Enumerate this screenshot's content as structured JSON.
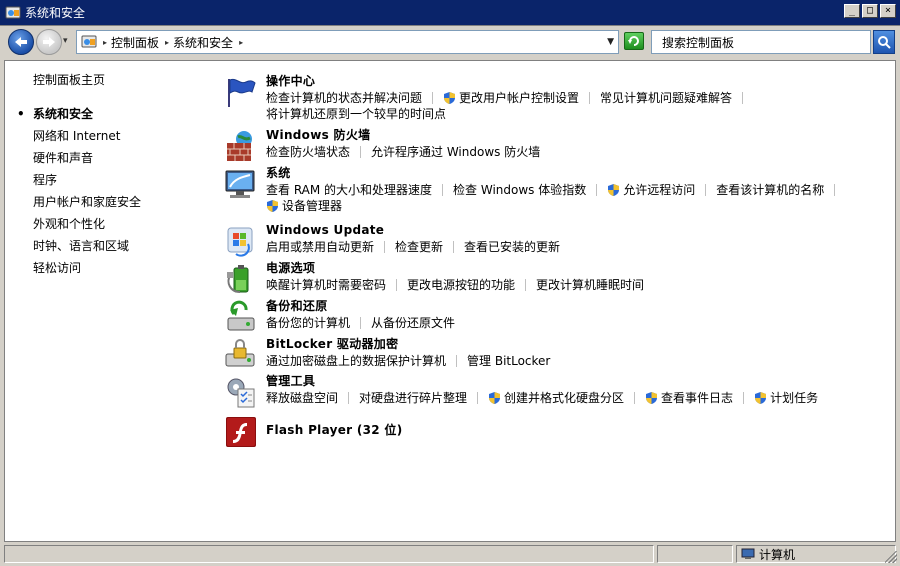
{
  "window": {
    "title": "系统和安全"
  },
  "nav": {
    "breadcrumbs": [
      "控制面板",
      "系统和安全"
    ],
    "search_placeholder": "搜索控制面板"
  },
  "sidebar": {
    "home": "控制面板主页",
    "items": [
      {
        "label": "系统和安全",
        "active": true
      },
      {
        "label": "网络和 Internet"
      },
      {
        "label": "硬件和声音"
      },
      {
        "label": "程序"
      },
      {
        "label": "用户帐户和家庭安全"
      },
      {
        "label": "外观和个性化"
      },
      {
        "label": "时钟、语言和区域"
      },
      {
        "label": "轻松访问"
      }
    ]
  },
  "sections": [
    {
      "title": "操作中心",
      "icon": "flag-icon",
      "links": [
        "检查计算机的状态并解决问题",
        "更改用户帐户控制设置",
        "常见计算机问题疑难解答",
        "将计算机还原到一个较早的时间点"
      ]
    },
    {
      "title": "Windows 防火墙",
      "icon": "firewall-icon",
      "links": [
        "检查防火墙状态",
        "允许程序通过 Windows 防火墙"
      ]
    },
    {
      "title": "系统",
      "icon": "computer-icon",
      "links": [
        "查看 RAM 的大小和处理器速度",
        "检查 Windows 体验指数",
        "允许远程访问",
        "查看该计算机的名称",
        "设备管理器"
      ]
    },
    {
      "title": "Windows Update",
      "icon": "windows-update-icon",
      "links": [
        "启用或禁用自动更新",
        "检查更新",
        "查看已安装的更新"
      ]
    },
    {
      "title": "电源选项",
      "icon": "power-icon",
      "links": [
        "唤醒计算机时需要密码",
        "更改电源按钮的功能",
        "更改计算机睡眠时间"
      ]
    },
    {
      "title": "备份和还原",
      "icon": "backup-icon",
      "links": [
        "备份您的计算机",
        "从备份还原文件"
      ]
    },
    {
      "title": "BitLocker 驱动器加密",
      "icon": "bitlocker-icon",
      "links": [
        "通过加密磁盘上的数据保护计算机",
        "管理 BitLocker"
      ]
    },
    {
      "title": "管理工具",
      "icon": "admin-tools-icon",
      "links": [
        "释放磁盘空间",
        "对硬盘进行碎片整理",
        "创建并格式化硬盘分区",
        "查看事件日志",
        "计划任务"
      ]
    },
    {
      "title": "Flash Player (32 位)",
      "icon": "flash-player-icon",
      "links": []
    }
  ],
  "statusbar": {
    "location": "计算机"
  },
  "colors": {
    "titlebar": "#0a246a",
    "link": "#000000",
    "background": "#ffffff",
    "chrome": "#d4d0c8"
  }
}
